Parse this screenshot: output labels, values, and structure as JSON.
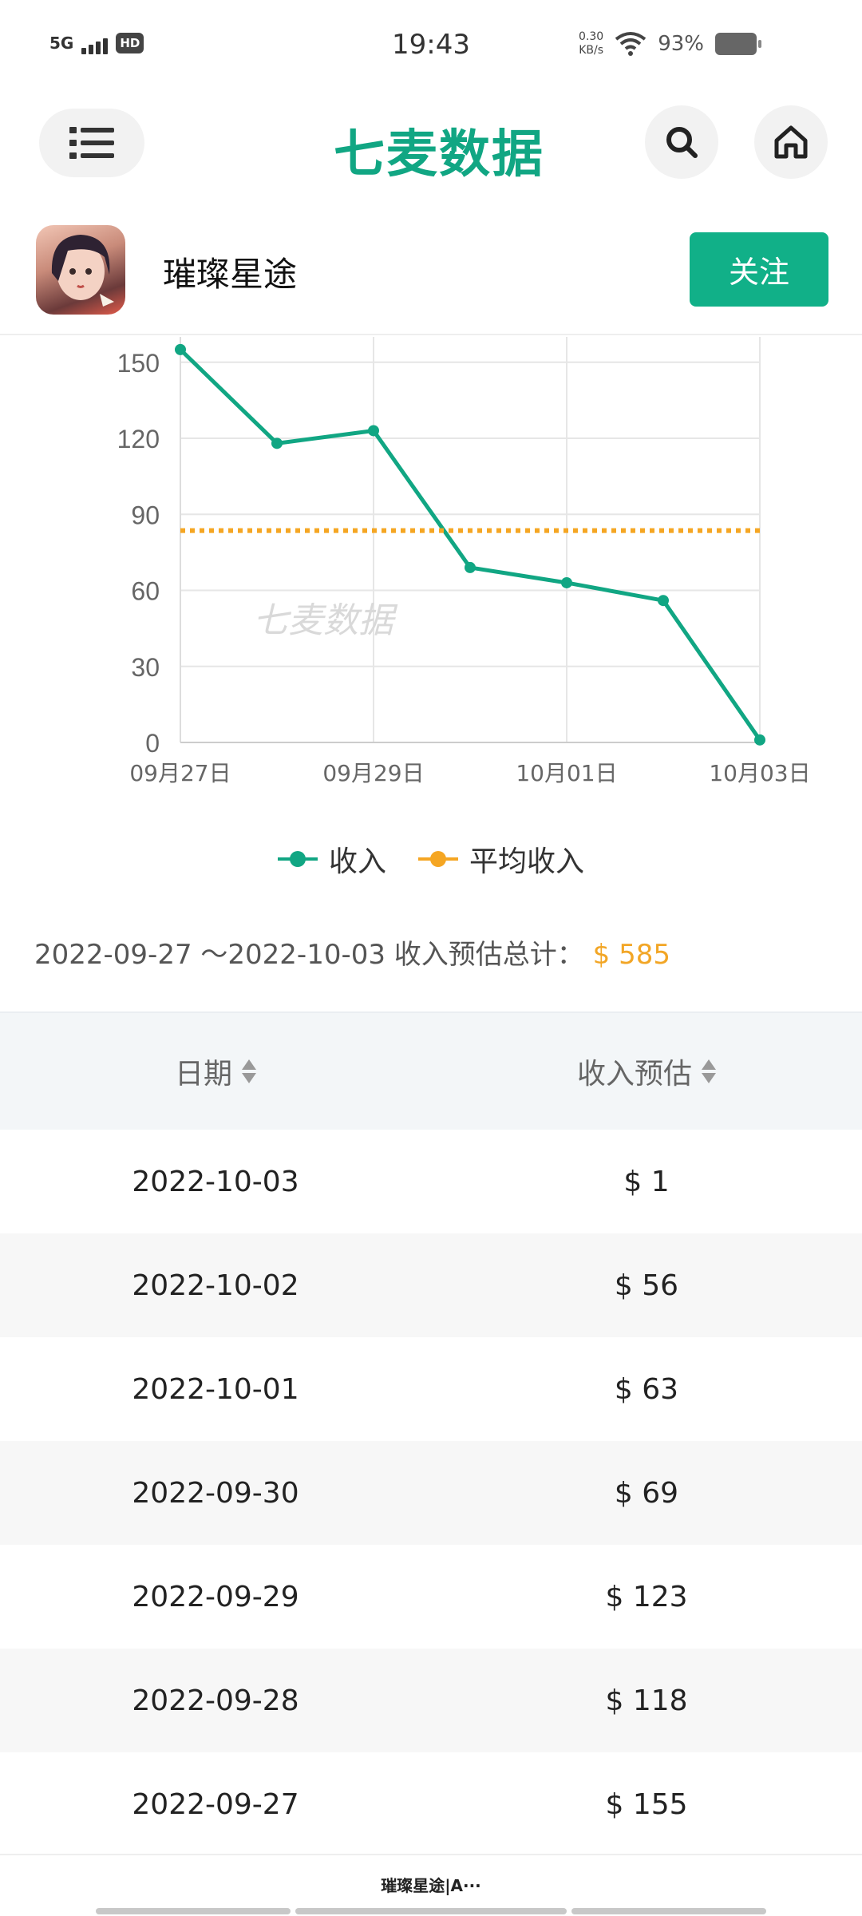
{
  "status_bar": {
    "network": "5G",
    "hd": "HD",
    "time": "19:43",
    "speed_value": "0.30",
    "speed_unit": "KB/s",
    "battery": "93%"
  },
  "header": {
    "logo": "七麦数据",
    "icons": [
      "menu-icon",
      "search-icon",
      "home-icon"
    ]
  },
  "app": {
    "name": "璀璨星途",
    "follow_label": "关注"
  },
  "chart_data": {
    "type": "line",
    "x": [
      "09月27日",
      "09月28日",
      "09月29日",
      "09月30日",
      "10月01日",
      "10月02日",
      "10月03日"
    ],
    "x_tick_labels": [
      "09月27日",
      "09月29日",
      "10月01日",
      "10月03日"
    ],
    "series": [
      {
        "name": "收入",
        "values": [
          155,
          118,
          123,
          69,
          63,
          56,
          1
        ],
        "color": "#11a683",
        "style": "solid"
      },
      {
        "name": "平均收入",
        "values": [
          83.6,
          83.6,
          83.6,
          83.6,
          83.6,
          83.6,
          83.6
        ],
        "color": "#f5a623",
        "style": "dotted"
      }
    ],
    "ylim": [
      0,
      160
    ],
    "y_ticks": [
      0,
      30,
      60,
      90,
      120,
      150
    ],
    "grid": true,
    "watermark": "七麦数据",
    "legend_position": "bottom"
  },
  "summary": {
    "range": "2022-09-27 ～2022-10-03 收入预估总计：",
    "amount": "$ 585"
  },
  "table": {
    "headers": [
      "日期",
      "收入预估"
    ],
    "rows": [
      [
        "2022-10-03",
        "$ 1"
      ],
      [
        "2022-10-02",
        "$ 56"
      ],
      [
        "2022-10-01",
        "$ 63"
      ],
      [
        "2022-09-30",
        "$ 69"
      ],
      [
        "2022-09-29",
        "$ 123"
      ],
      [
        "2022-09-28",
        "$ 118"
      ],
      [
        "2022-09-27",
        "$ 155"
      ]
    ]
  },
  "bottom": {
    "title": "璀璨星途|A···"
  }
}
